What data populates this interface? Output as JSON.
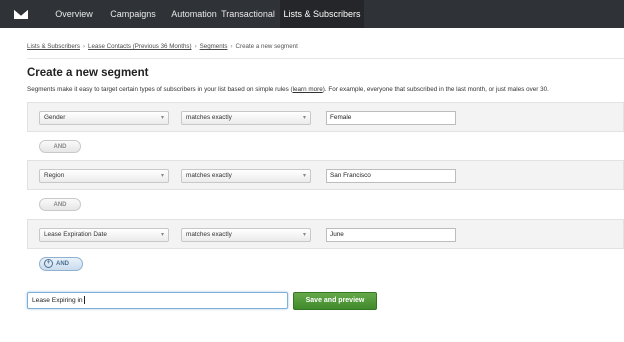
{
  "nav": {
    "items": [
      "Overview",
      "Campaigns",
      "Automation",
      "Transactional",
      "Lists & Subscribers"
    ],
    "active_index": 4
  },
  "breadcrumb": {
    "links": [
      "Lists & Subscribers",
      "Lease Contacts (Previous 36 Months)",
      "Segments"
    ],
    "separator": "›",
    "current": "Create a new segment"
  },
  "page": {
    "title": "Create a new segment",
    "intro_before": "Segments make it easy to target certain types of subscribers in your list based on simple rules (",
    "intro_link": "learn more",
    "intro_after": "). For example, everyone that subscribed in the last month, or just males over 30."
  },
  "rules": [
    {
      "field": "Gender",
      "operator": "matches exactly",
      "value": "Female"
    },
    {
      "field": "Region",
      "operator": "matches exactly",
      "value": "San Francisco"
    },
    {
      "field": "Lease Expiration Date",
      "operator": "matches exactly",
      "value": "June"
    }
  ],
  "connectors": {
    "and_label": "AND",
    "add_and_label": "AND",
    "add_icon": "plus-circle-icon"
  },
  "segment_name": {
    "value": "Lease Expiring in"
  },
  "actions": {
    "save_label": "Save and preview"
  },
  "colors": {
    "nav_bg": "#2f3236",
    "save_button": "#4c9a36",
    "focus_border": "#7fb0d8"
  }
}
